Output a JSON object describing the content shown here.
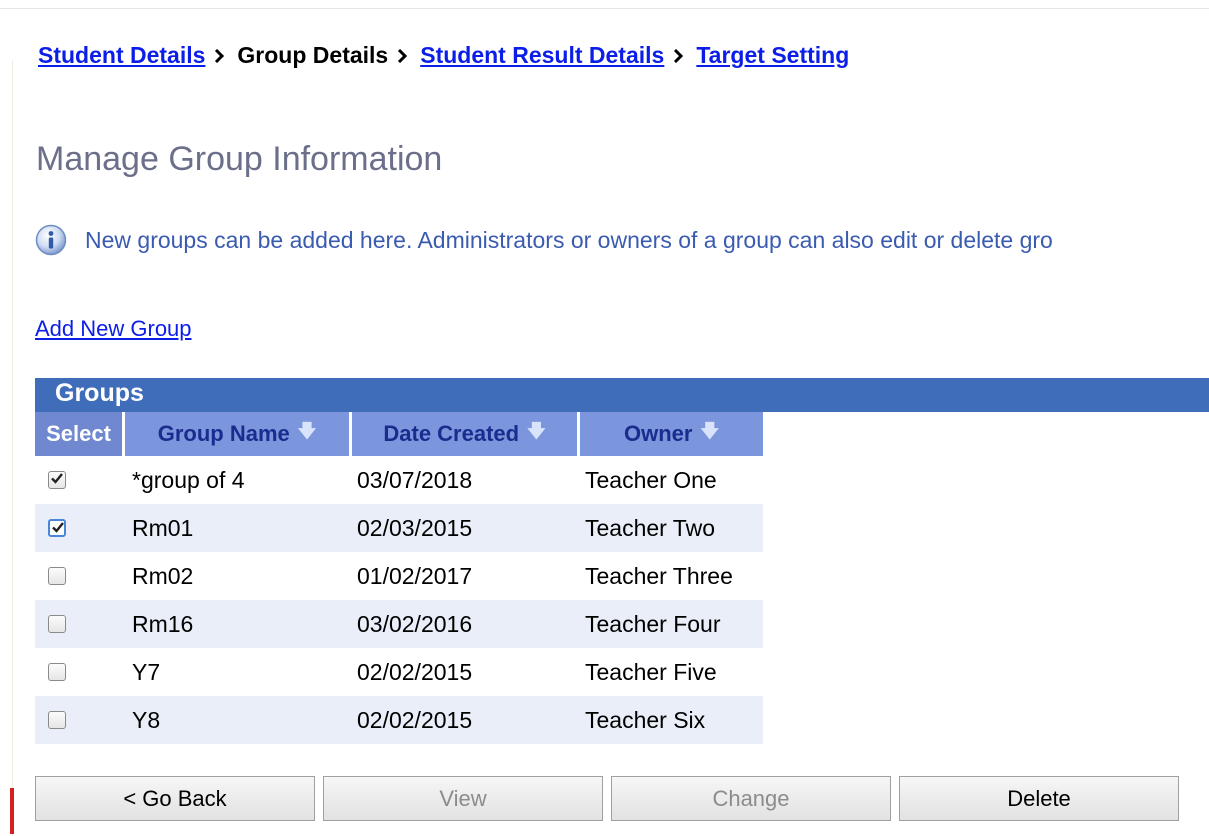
{
  "breadcrumb": {
    "items": [
      {
        "label": "Student Details",
        "link": true
      },
      {
        "label": "Group Details",
        "link": false
      },
      {
        "label": "Student Result Details",
        "link": true
      },
      {
        "label": "Target Setting",
        "link": true
      }
    ]
  },
  "page": {
    "title": "Manage Group Information",
    "info_text": "New groups can be added here. Administrators or owners of a group can also edit or delete gro",
    "add_link": "Add New Group"
  },
  "groups_table": {
    "title": "Groups",
    "columns": {
      "select": "Select",
      "name": "Group Name",
      "date": "Date Created",
      "owner": "Owner"
    },
    "rows": [
      {
        "checked": true,
        "focused": false,
        "name": "*group of 4",
        "date": "03/07/2018",
        "owner": "Teacher One"
      },
      {
        "checked": true,
        "focused": true,
        "name": "Rm01",
        "date": "02/03/2015",
        "owner": "Teacher Two"
      },
      {
        "checked": false,
        "focused": false,
        "name": "Rm02",
        "date": "01/02/2017",
        "owner": "Teacher Three"
      },
      {
        "checked": false,
        "focused": false,
        "name": "Rm16",
        "date": "03/02/2016",
        "owner": "Teacher Four"
      },
      {
        "checked": false,
        "focused": false,
        "name": "Y7",
        "date": "02/02/2015",
        "owner": "Teacher Five"
      },
      {
        "checked": false,
        "focused": false,
        "name": "Y8",
        "date": "02/02/2015",
        "owner": "Teacher Six"
      }
    ]
  },
  "buttons": {
    "go_back": "< Go Back",
    "view": "View",
    "change": "Change",
    "delete": "Delete"
  },
  "colors": {
    "header_band": "#3f6db9",
    "column_header": "#7b96dc",
    "link": "#0b1ee8",
    "title": "#6b6f8a",
    "info_text": "#3a5bb0",
    "alt_row": "#e9eef8"
  },
  "icons": {
    "breadcrumb_separator": "chevron-right-icon",
    "info": "info-icon",
    "sort": "sort-down-arrow-icon",
    "checkbox": "checkbox-icon"
  }
}
